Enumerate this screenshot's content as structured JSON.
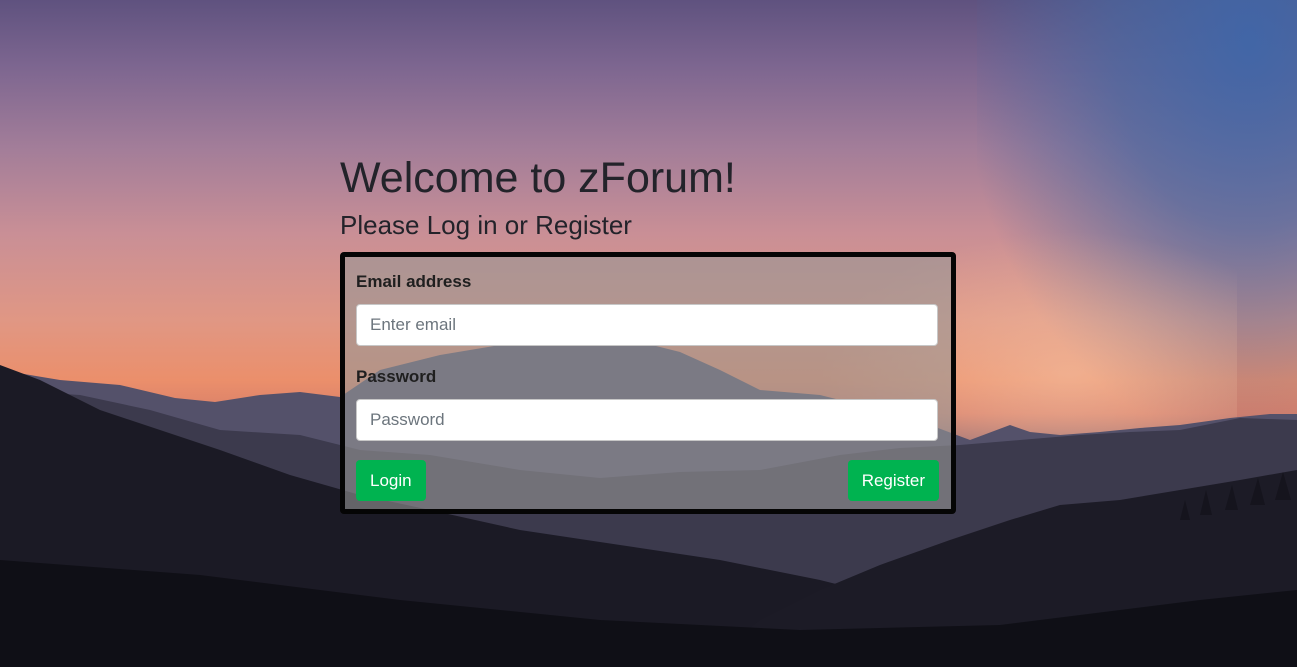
{
  "page": {
    "title": "Welcome to zForum!",
    "subtitle": "Please Log in or Register"
  },
  "form": {
    "email_label": "Email address",
    "email_value": "",
    "email_placeholder": "Enter email",
    "password_label": "Password",
    "password_value": "",
    "password_placeholder": "Password",
    "login_label": "Login",
    "register_label": "Register"
  },
  "colors": {
    "button_green": "#00b350",
    "card_border": "#050505",
    "text": "#23232a"
  },
  "background": {
    "scene": "mountain-sunset-photo"
  }
}
